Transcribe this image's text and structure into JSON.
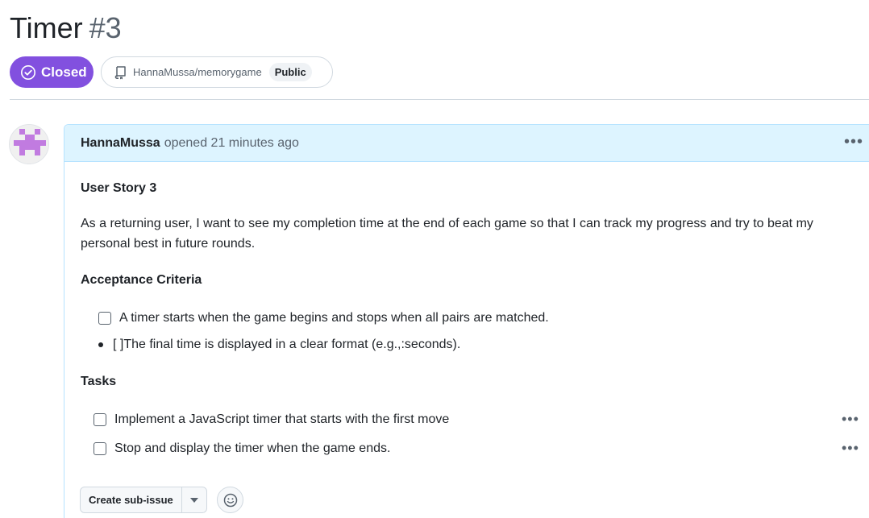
{
  "issue": {
    "title": "Timer",
    "number": "#3",
    "state_label": "Closed",
    "repo": "HannaMussa/memorygame",
    "visibility": "Public"
  },
  "comment": {
    "author": "HannaMussa",
    "meta": "opened 21 minutes ago",
    "heading_story": "User Story 3",
    "story_text": "As a returning user, I want to see my completion time at the end of each game so that I can track my progress and try to beat my personal best in future rounds.",
    "heading_criteria": "Acceptance Criteria",
    "criteria": [
      "A timer starts when the game begins and stops when all pairs are matched.",
      "[ ]The final time is displayed in a clear format (e.g.,:seconds)."
    ],
    "heading_tasks": "Tasks",
    "tasks": [
      "Implement a JavaScript timer that starts with the first move",
      "Stop and display the timer when the game ends."
    ]
  },
  "actions": {
    "create_sub_issue": "Create sub-issue"
  },
  "colors": {
    "closed_purple": "#8250df",
    "header_blue": "#ddf4ff",
    "border_blue": "#b6e3ff"
  },
  "icons": [
    "check-circle-icon",
    "repo-icon",
    "kebab-horizontal-icon",
    "triangle-down-icon",
    "smiley-icon"
  ]
}
